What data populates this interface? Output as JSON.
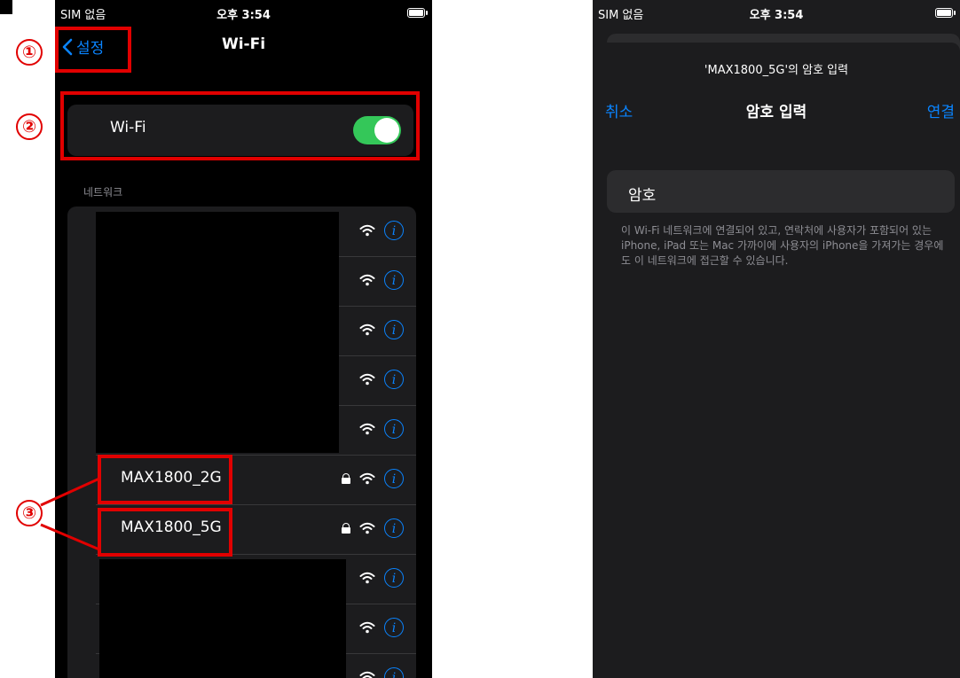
{
  "colors": {
    "accent": "#0a84ff",
    "toggle_on": "#34c759",
    "annotation": "#e10000"
  },
  "phone1": {
    "status": {
      "sim": "SIM 없음",
      "time": "오후 3:54"
    },
    "nav": {
      "back_label": "설정",
      "title": "Wi-Fi"
    },
    "wifi_toggle": {
      "label": "Wi-Fi",
      "on": true
    },
    "section_header": "네트워크",
    "networks": [
      {
        "name": "",
        "locked": false,
        "icon": "wifi-icon"
      },
      {
        "name": "",
        "locked": false,
        "icon": "wifi-icon"
      },
      {
        "name": "",
        "locked": false,
        "icon": "wifi-icon"
      },
      {
        "name": "",
        "locked": false,
        "icon": "wifi-icon"
      },
      {
        "name": "",
        "locked": false,
        "icon": "wifi-icon"
      },
      {
        "name": "MAX1800_2G",
        "locked": true,
        "icon": "wifi-icon"
      },
      {
        "name": "MAX1800_5G",
        "locked": true,
        "icon": "wifi-icon"
      },
      {
        "name": "",
        "locked": false,
        "icon": "wifi-icon"
      },
      {
        "name": "",
        "locked": false,
        "icon": "wifi-icon"
      },
      {
        "name": "",
        "locked": false,
        "icon": "wifi-icon"
      }
    ]
  },
  "annotations": {
    "n1": "①",
    "n2": "②",
    "n3": "③"
  },
  "phone2": {
    "status": {
      "sim": "SIM 없음",
      "time": "오후 3:54"
    },
    "prompt": "'MAX1800_5G'의 암호 입력",
    "cancel_label": "취소",
    "title": "암호 입력",
    "join_label": "연결",
    "password_label": "암호",
    "password_value": "",
    "note": "이 Wi-Fi 네트워크에 연결되어 있고, 연락처에 사용자가 포함되어 있는 iPhone, iPad 또는 Mac 가까이에 사용자의 iPhone을 가져가는 경우에도 이 네트워크에 접근할 수 있습니다."
  }
}
